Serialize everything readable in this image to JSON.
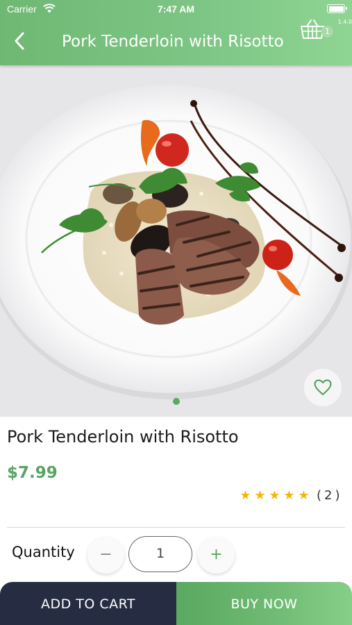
{
  "status_bar": {
    "carrier": "Carrier",
    "time": "7:47 AM",
    "version": "1.4.0"
  },
  "header": {
    "title": "Pork Tenderloin with Risotto",
    "back_icon": "chevron-left-icon",
    "cart_icon": "basket-icon",
    "cart_count": "1"
  },
  "gallery": {
    "image": "plated-pork-tenderloin-with-risotto",
    "favorite_icon": "heart-outline-icon"
  },
  "product": {
    "name": "Pork Tenderloin with Risotto",
    "price": "$7.99",
    "rating": 5,
    "rating_max": 5,
    "rating_count": "(2)"
  },
  "quantity": {
    "label": "Quantity",
    "minus": "−",
    "value": "1",
    "plus": "+"
  },
  "actions": {
    "add_to_cart": "ADD TO CART",
    "buy_now": "BUY NOW"
  },
  "colors": {
    "brand_green": "#6fb873",
    "dark_navy": "#262c42",
    "price_green": "#58a561",
    "star": "#f2b707"
  }
}
